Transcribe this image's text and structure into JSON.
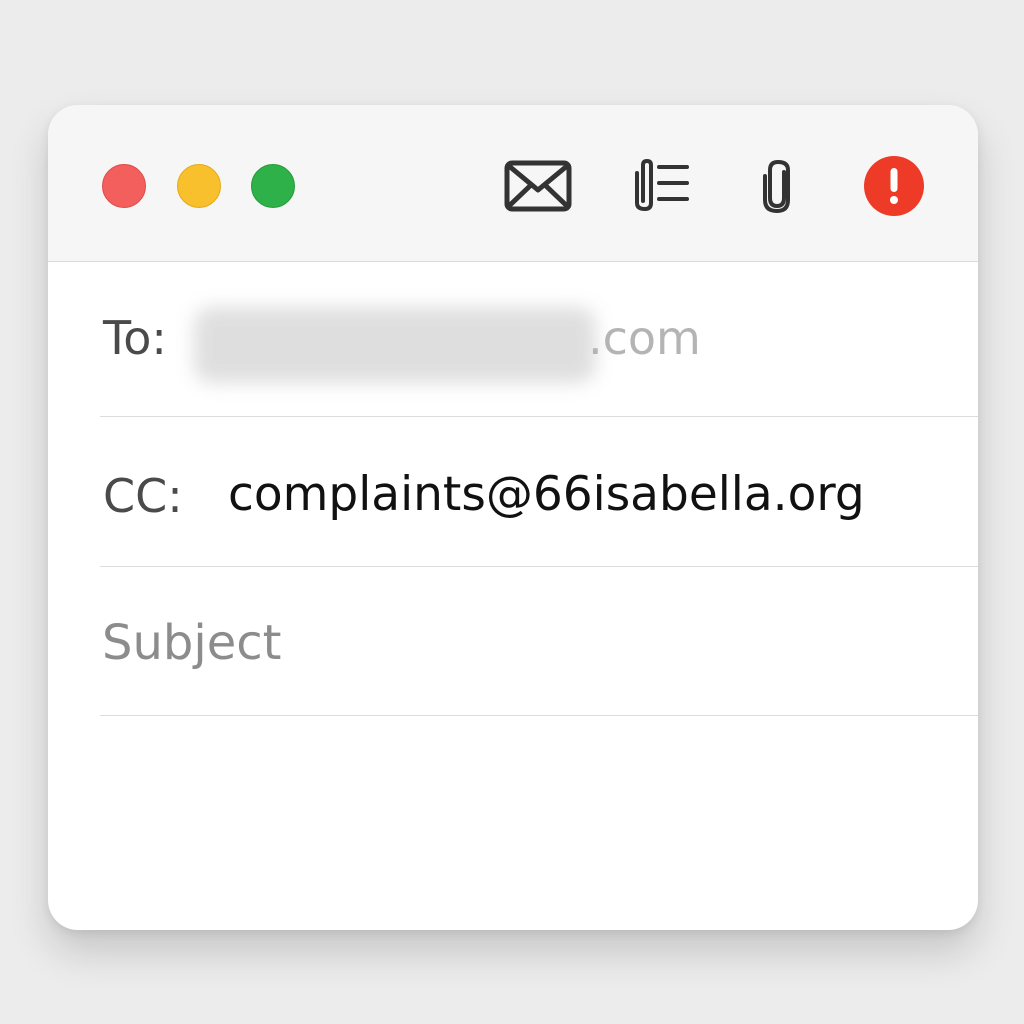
{
  "window": {
    "traffic_lights": {
      "close_color": "#f25f5c",
      "minimize_color": "#f8c02c",
      "zoom_color": "#2fb14a"
    },
    "toolbar": {
      "icons": [
        "envelope-icon",
        "format-list-icon",
        "paperclip-icon",
        "alert-icon"
      ],
      "alert_color": "#ee3b27"
    }
  },
  "compose": {
    "to_label": "To:",
    "to_value_visible": ".com",
    "cc_label": "CC:",
    "cc_value": "complaints@66isabella.org",
    "subject_placeholder": "Subject",
    "subject_value": ""
  }
}
